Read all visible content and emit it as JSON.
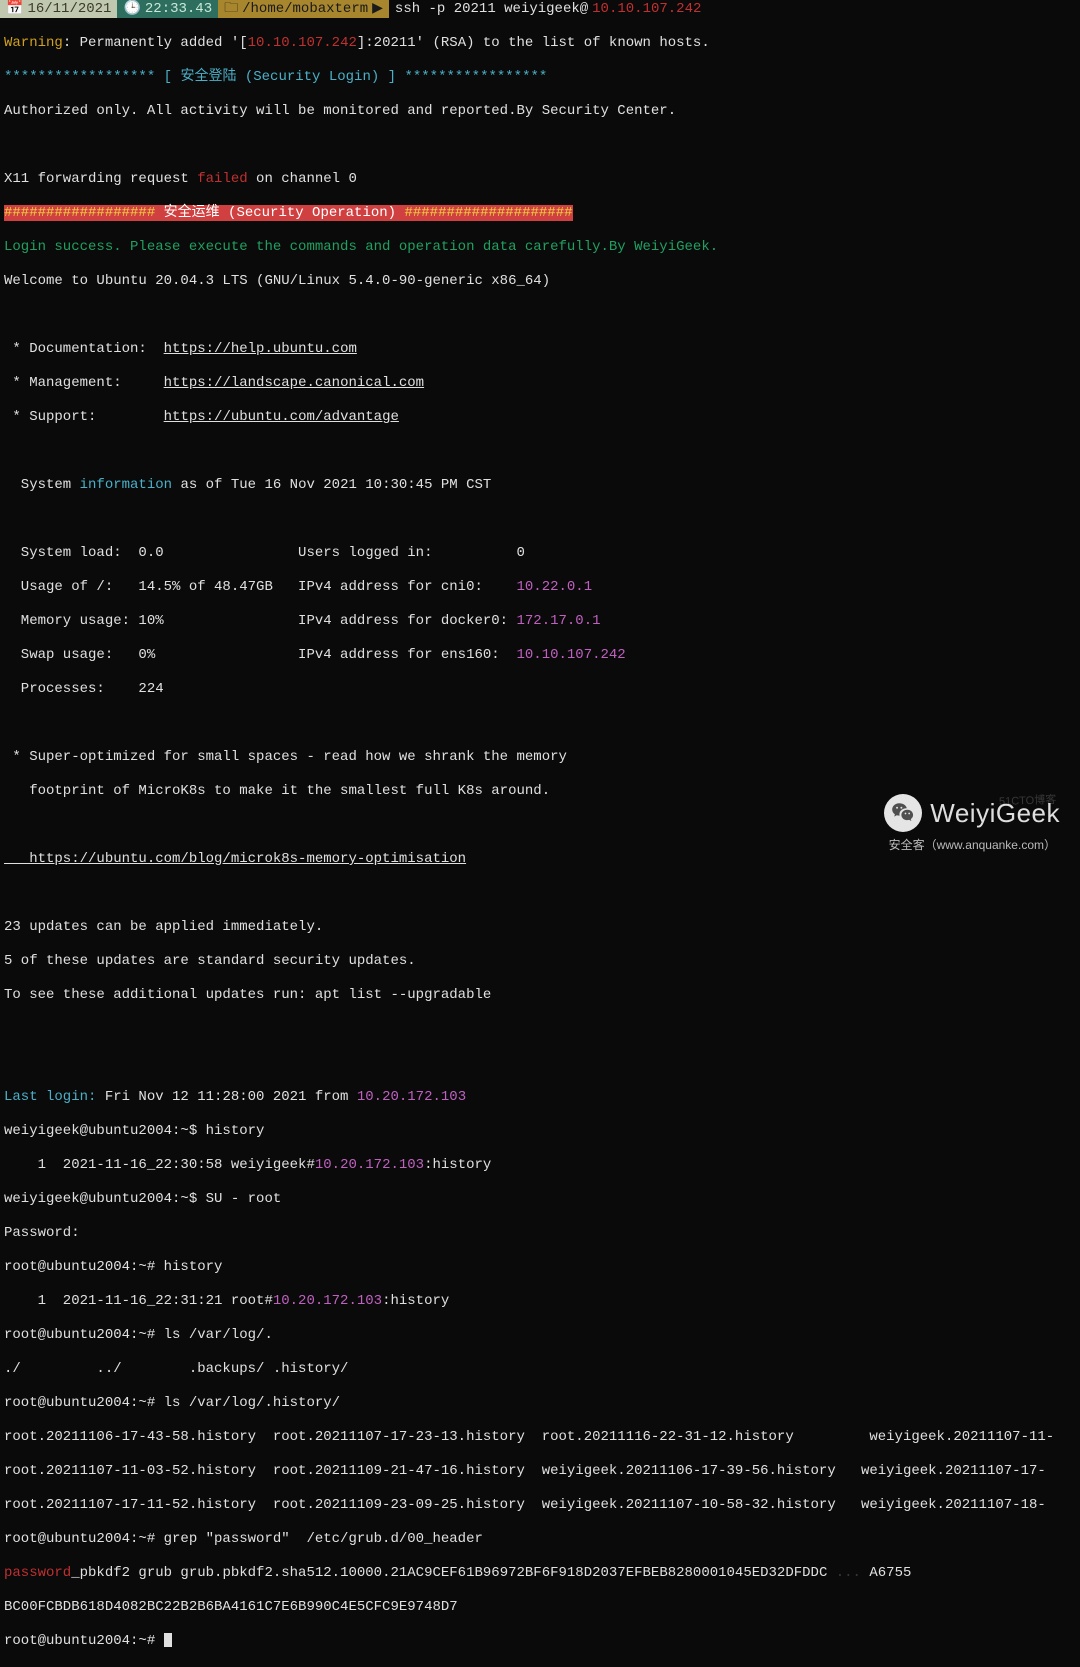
{
  "statusbar": {
    "date": "16/11/2021",
    "time": "22:33.43",
    "path": "/home/mobaxterm",
    "cmd_prefix": "ssh -p 20211 weiyigeek@",
    "cmd_ip": "10.10.107.242"
  },
  "warning": {
    "label": "Warning",
    "text1": ": Permanently added '[",
    "ip": "10.10.107.242",
    "text2": "]:20211' (RSA) to the list of known hosts."
  },
  "login_banner": {
    "stars1": "******************",
    "label": " [ 安全登陆 (Security Login) ] ",
    "stars2": "*****************",
    "auth": "Authorized only. All activity will be monitored and reported.By Security Center."
  },
  "x11": {
    "pre": "X11 forwarding request ",
    "failed": "failed",
    "post": " on channel 0"
  },
  "secop": {
    "hash1": "##################",
    "label": " 安全运维 (Security Operation) ",
    "hash2": "####################"
  },
  "login_success": "Login success. Please execute the commands and operation data carefully.By WeiyiGeek.",
  "welcome": "Welcome to Ubuntu 20.04.3 LTS (GNU/Linux 5.4.0-90-generic x86_64)",
  "links": {
    "doc_l": " * Documentation:  ",
    "doc_u": "https://help.ubuntu.com",
    "mgmt_l": " * Management:     ",
    "mgmt_u": "https://landscape.canonical.com",
    "sup_l": " * Support:        ",
    "sup_u": "https://ubuntu.com/advantage"
  },
  "sysinfo": {
    "pre": "  System ",
    "word": "information",
    "post": " as of Tue 16 Nov 2021 10:30:45 PM CST",
    "load": "  System load:  0.0                Users logged in:          0",
    "usage1": "  Usage of /:   14.5% of 48.47GB   IPv4 address for cni0:    ",
    "usage1_ip": "10.22.0.1",
    "mem": "  Memory usage: 10%                IPv4 address for docker0: ",
    "mem_ip": "172.17.0.1",
    "swap": "  Swap usage:   0%                 IPv4 address for ens160:  ",
    "swap_ip": "10.10.107.242",
    "proc": "  Processes:    224"
  },
  "microk8s": {
    "line1": " * Super-optimized for small spaces - read how we shrank the memory",
    "line2": "   footprint of MicroK8s to make it the smallest full K8s around.",
    "url": "   https://ubuntu.com/blog/microk8s-memory-optimisation"
  },
  "updates": {
    "l1": "23 updates can be applied immediately.",
    "l2": "5 of these updates are standard security updates.",
    "l3": "To see these additional updates run: apt list --upgradable"
  },
  "lastlogin": {
    "label": "Last login:",
    "mid": " Fri Nov 12 11:28:00 2021 from ",
    "ip": "10.20.172.103"
  },
  "session": {
    "p1": "weiyigeek@ubuntu2004:~$ history",
    "h1pre": "    1  2021-11-16_22:30:58 weiyigeek#",
    "h1ip": "10.20.172.103",
    "h1post": ":history",
    "p2": "weiyigeek@ubuntu2004:~$ SU - root",
    "pw": "Password:",
    "p3": "root@ubuntu2004:~# history",
    "h2pre": "    1  2021-11-16_22:31:21 root#",
    "h2ip": "10.20.172.103",
    "h2post": ":history",
    "p4": "root@ubuntu2004:~# ls /var/log/.",
    "ls1": "./         ../        .backups/ .history/",
    "p5": "root@ubuntu2004:~# ls /var/log/.history/",
    "ls2a": "root.20211106-17-43-58.history  root.20211107-17-23-13.history  root.20211116-22-31-12.history         weiyigeek.20211107-11-",
    "ls2b": "root.20211107-11-03-52.history  root.20211109-21-47-16.history  weiyigeek.20211106-17-39-56.history   weiyigeek.20211107-17-",
    "ls2c": "root.20211107-17-11-52.history  root.20211109-23-09-25.history  weiyigeek.20211107-10-58-32.history   weiyigeek.20211107-18-",
    "p6": "root@ubuntu2004:~# grep \"password\"  /etc/grub.d/00_header",
    "pword": "password",
    "grub1": "_pbkdf2 grub grub.pbkdf2.sha512.10000.21AC9CEF61B96972BF6F918D2037EFBEB8280001045ED32DFDDC",
    "grub1b": "A6755",
    "grub2": "BC00FCBDB618D4082BC22B2B6BA4161C7E6B990C4E5CFC9E9748D7",
    "p7": "root@ubuntu2004:~# "
  },
  "watermark": {
    "brand": "WeiyiGeek",
    "anquanke": "安全客（www.anquanke.com）",
    "cto": "51CTO博客"
  }
}
